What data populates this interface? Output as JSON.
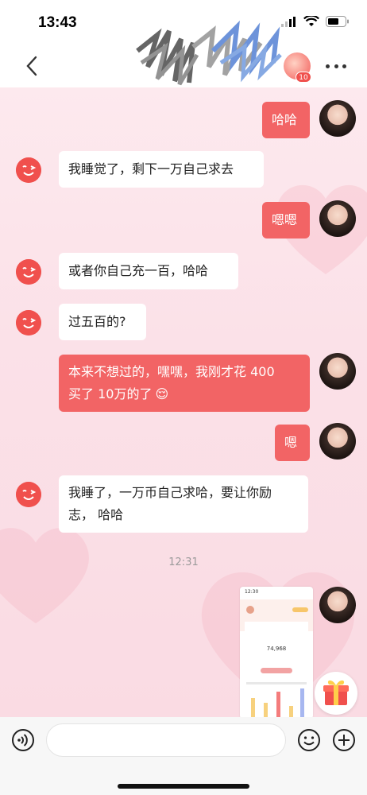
{
  "status_bar": {
    "time": "13:43"
  },
  "header": {
    "peer_badge_count": "10",
    "icons": [
      "back-icon",
      "more-icon"
    ]
  },
  "colors": {
    "outgoing_bubble": "#f26465",
    "incoming_bubble": "#ffffff",
    "background": "#fbe4ea",
    "brand_red": "#f0504d"
  },
  "messages": [
    {
      "side": "out",
      "text": "哈哈"
    },
    {
      "side": "in",
      "text": "我睡觉了，剩下一万自己求去"
    },
    {
      "side": "out",
      "text": "嗯嗯"
    },
    {
      "side": "in",
      "text": "或者你自己充一百，哈哈"
    },
    {
      "side": "in",
      "text": "过五百的?"
    },
    {
      "side": "out",
      "line1": "本来不想过的，嘿嘿，我刚才花 400",
      "line2": "买了 10万的了",
      "emoji": "😌"
    },
    {
      "side": "out",
      "text": "嗯"
    },
    {
      "side": "in",
      "line1": "我睡了，一万币自己求哈，要让你励",
      "line2": "志， 哈哈"
    }
  ],
  "timestamp": "12:31",
  "screenshot_thumb": {
    "time": "12:30",
    "value": "74,968"
  },
  "input": {
    "placeholder": ""
  }
}
